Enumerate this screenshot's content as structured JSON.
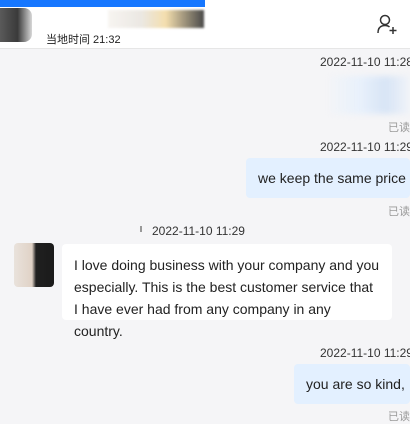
{
  "header": {
    "local_time": "当地时间 21:32"
  },
  "messages": [
    {
      "timestamp": "2022-11-10 11:28",
      "read": "已读"
    },
    {
      "timestamp": "2022-11-10 11:29",
      "text": "we keep the same price",
      "read": "已读"
    },
    {
      "timestamp": "2022-11-10 11:29",
      "text": "I love doing business with your company and you especially. This is the best customer service that I have ever had from any company in any country."
    },
    {
      "timestamp": "2022-11-10 11:29",
      "text": "you are so kind,",
      "read": "已读"
    }
  ],
  "colors": {
    "accent": "#1677ff",
    "outgoing_bubble": "#e3f0ff",
    "incoming_bubble": "#ffffff",
    "background": "#f5f5f7"
  },
  "icons": {
    "add_contact": "add-contact-icon"
  }
}
